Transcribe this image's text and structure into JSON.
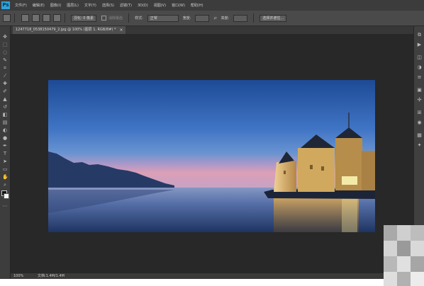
{
  "menubar": {
    "items": [
      "文件(F)",
      "编辑(E)",
      "图像(I)",
      "图层(L)",
      "文字(Y)",
      "选择(S)",
      "滤镜(T)",
      "3D(D)",
      "视图(V)",
      "窗口(W)",
      "帮助(H)"
    ]
  },
  "options_bar": {
    "feather_label": "羽化: 0 像素",
    "antialias_label": "消除锯齿",
    "style_label": "样式:",
    "style_value": "正常",
    "width_label": "宽度:",
    "height_label": "高度:",
    "refine_edge_label": "选择并遮住..."
  },
  "document": {
    "tab_label": "1247718_0538150479_2.jpg @ 100% (图层 1, RGB/8#) *",
    "close_glyph": "×"
  },
  "status_bar": {
    "zoom": "100%",
    "doc_size": "文档:1.4M/1.4M"
  },
  "tools": [
    {
      "icon": "move-tool-icon",
      "glyph": "✥"
    },
    {
      "icon": "marquee-tool-icon",
      "glyph": "⬚"
    },
    {
      "icon": "lasso-tool-icon",
      "glyph": "◌"
    },
    {
      "icon": "quick-select-tool-icon",
      "glyph": "✎"
    },
    {
      "icon": "crop-tool-icon",
      "glyph": "⌗"
    },
    {
      "icon": "eyedropper-tool-icon",
      "glyph": "⁄"
    },
    {
      "icon": "healing-tool-icon",
      "glyph": "✚"
    },
    {
      "icon": "brush-tool-icon",
      "glyph": "✐"
    },
    {
      "icon": "stamp-tool-icon",
      "glyph": "▲"
    },
    {
      "icon": "history-brush-icon",
      "glyph": "↺"
    },
    {
      "icon": "eraser-tool-icon",
      "glyph": "◧"
    },
    {
      "icon": "gradient-tool-icon",
      "glyph": "▤"
    },
    {
      "icon": "blur-tool-icon",
      "glyph": "◐"
    },
    {
      "icon": "dodge-tool-icon",
      "glyph": "●"
    },
    {
      "icon": "pen-tool-icon",
      "glyph": "✒"
    },
    {
      "icon": "type-tool-icon",
      "glyph": "T"
    },
    {
      "icon": "path-select-tool-icon",
      "glyph": "➤"
    },
    {
      "icon": "shape-tool-icon",
      "glyph": "▭"
    },
    {
      "icon": "hand-tool-icon",
      "glyph": "✋"
    },
    {
      "icon": "zoom-tool-icon",
      "glyph": "⌕"
    },
    {
      "icon": "edit-toolbar-icon",
      "glyph": "⋯"
    }
  ],
  "panel_buttons": [
    {
      "icon": "history-panel-icon",
      "glyph": "⧉"
    },
    {
      "icon": "actions-panel-icon",
      "glyph": "▶"
    },
    {
      "icon": "layers-panel-icon",
      "glyph": "◫"
    },
    {
      "icon": "adjustments-panel-icon",
      "glyph": "◑"
    },
    {
      "icon": "properties-panel-icon",
      "glyph": "≡"
    },
    {
      "icon": "libraries-panel-icon",
      "glyph": "▣"
    },
    {
      "icon": "paths-panel-icon",
      "glyph": "✣"
    },
    {
      "icon": "channels-panel-icon",
      "glyph": "⊞"
    },
    {
      "icon": "color-panel-icon",
      "glyph": "◉"
    },
    {
      "icon": "swatches-panel-icon",
      "glyph": "▦"
    },
    {
      "icon": "brush-panel-icon",
      "glyph": "✦"
    }
  ],
  "colors": {
    "app_bg": "#535353",
    "workspace_bg": "#282828",
    "sky_top": "#1f4b96",
    "sky_bottom": "#e0a3c0",
    "castle_light": "#e6c07a"
  }
}
